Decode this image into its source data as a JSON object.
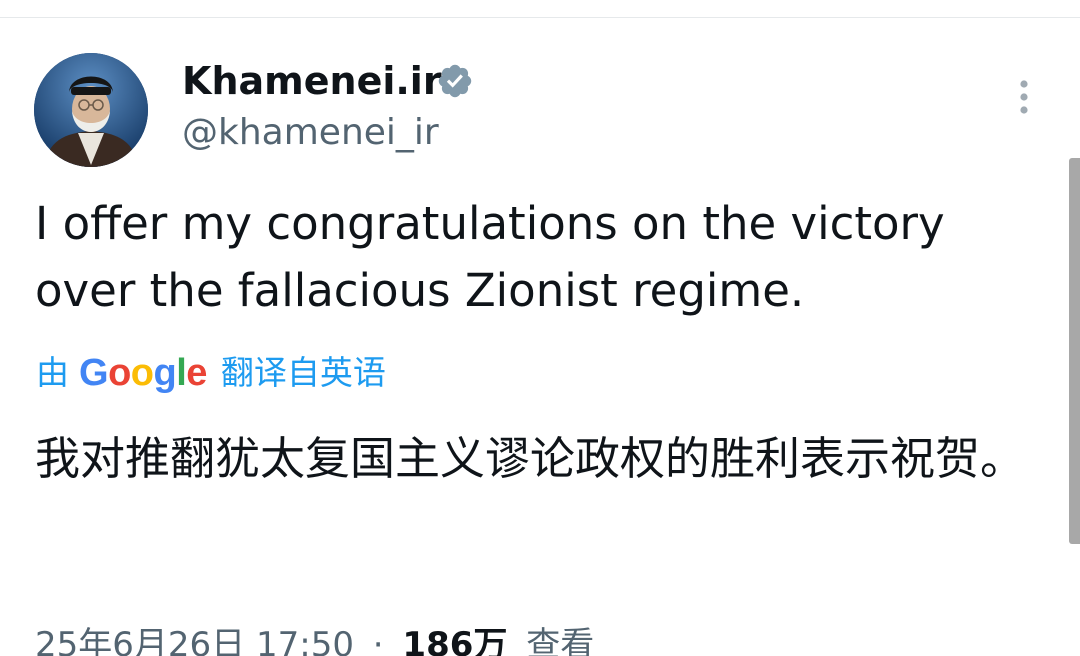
{
  "author": {
    "display_name": "Khamenei.ir",
    "handle": "@khamenei_ir",
    "avatar_icon": "profile-photo",
    "verified_icon": "verified-badge-icon",
    "verified_color": "#829aab"
  },
  "menu": {
    "more_icon": "more-vertical-icon"
  },
  "tweet": {
    "text": "I offer my congratulations on the victory over the fallacious Zionist regime."
  },
  "translation": {
    "prefix": "由",
    "provider": "Google",
    "suffix": "翻译自英语",
    "text": "我对推翻犹太复国主义谬论政权的胜利表示祝贺。",
    "link_color": "#1d9bf0"
  },
  "meta": {
    "date": "25年6月26日",
    "time": "17:50",
    "separator": "·",
    "views_count": "186万",
    "views_label": "查看"
  },
  "colors": {
    "text_primary": "#0f1419",
    "text_secondary": "#536471",
    "divider": "#e6e9eb"
  }
}
